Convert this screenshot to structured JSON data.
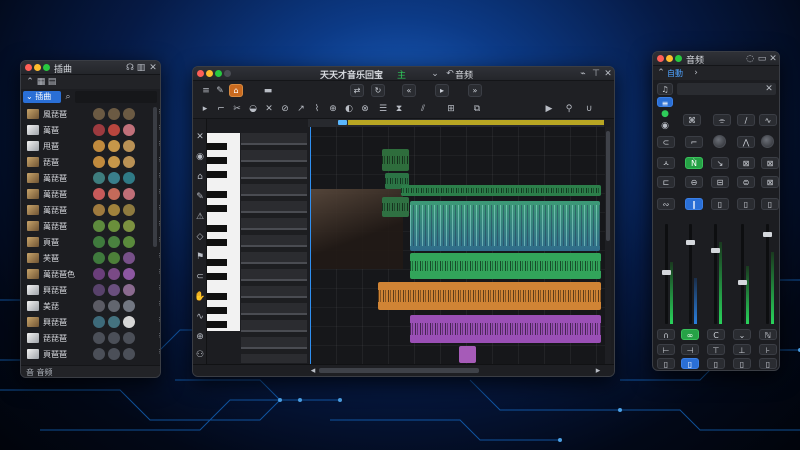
{
  "library": {
    "title": "插曲",
    "active_tab": "插曲",
    "search_placeholder": "",
    "footer": "音 音频",
    "items": [
      {
        "label": "風琵琶",
        "swatch": [
          "#6b5a43",
          "#6b5a43",
          "#6b5a43"
        ],
        "white": false
      },
      {
        "label": "萬琶",
        "swatch": [
          "#9c3a3f",
          "#b8463e",
          "#c0707a"
        ],
        "white": true
      },
      {
        "label": "甩琶",
        "swatch": [
          "#c08a3d",
          "#c69749",
          "#b99155"
        ],
        "white": true
      },
      {
        "label": "琵琶",
        "swatch": [
          "#c08a3d",
          "#c69749",
          "#b99155"
        ],
        "white": false
      },
      {
        "label": "萬琵琶",
        "swatch": [
          "#3e7d7e",
          "#3a7f8c",
          "#2f7a86"
        ],
        "white": false
      },
      {
        "label": "萬琵琶",
        "swatch": [
          "#c75a5a",
          "#c46a5a",
          "#bf6e77"
        ],
        "white": false
      },
      {
        "label": "萬琵琶",
        "swatch": [
          "#9f7a3e",
          "#a0823c",
          "#8e7a3f"
        ],
        "white": false
      },
      {
        "label": "萬琵琶",
        "swatch": [
          "#5d8a3d",
          "#6a8f3b",
          "#7c9140"
        ],
        "white": false
      },
      {
        "label": "頁琶",
        "swatch": [
          "#3f7a3d",
          "#4a823f",
          "#5a8a3c"
        ],
        "white": false
      },
      {
        "label": "芙琶",
        "swatch": [
          "#3f7a3d",
          "#4d7f39",
          "#775089"
        ],
        "white": false
      },
      {
        "label": "萬琵琶色",
        "swatch": [
          "#6a3e7a",
          "#7a4a86",
          "#8c57a1"
        ],
        "white": false
      },
      {
        "label": "興琵琶",
        "swatch": [
          "#58426b",
          "#6a4f7e",
          "#8a6a8f"
        ],
        "white": true
      },
      {
        "label": "美琵",
        "swatch": [
          "#5b5b64",
          "#62666f",
          "#727782"
        ],
        "white": true
      },
      {
        "label": "興琵琶",
        "swatch": [
          "#3d6a7a",
          "#44727f",
          "#d6d6d6"
        ],
        "white": false
      },
      {
        "label": "琵琵琶",
        "swatch": [
          "#4b4f58",
          "#4b4f58",
          "#4b4f58"
        ],
        "white": true
      },
      {
        "label": "頁琶琶",
        "swatch": [
          "#4b4f58",
          "#4b4f58",
          "#4b4f58"
        ],
        "white": true
      }
    ]
  },
  "daw": {
    "title": "天天才音乐回宝",
    "title_badge": "主",
    "menu_label": "音频"
  },
  "mixer": {
    "title": "音频",
    "tab_label": "自動"
  }
}
